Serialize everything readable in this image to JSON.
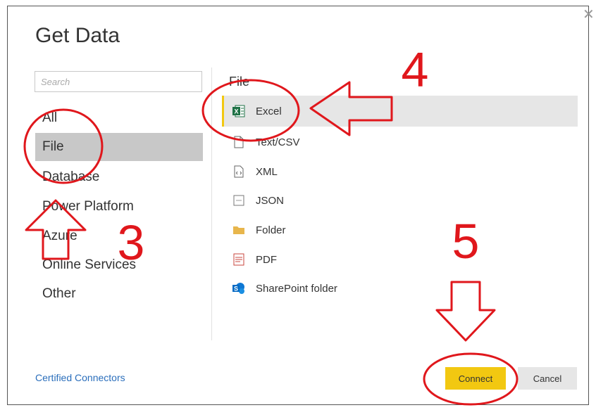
{
  "dialog": {
    "title": "Get Data",
    "close_glyph": "✕",
    "search": {
      "placeholder": "Search",
      "value": ""
    },
    "categories": [
      {
        "label": "All",
        "selected": false
      },
      {
        "label": "File",
        "selected": true
      },
      {
        "label": "Database",
        "selected": false
      },
      {
        "label": "Power Platform",
        "selected": false
      },
      {
        "label": "Azure",
        "selected": false
      },
      {
        "label": "Online Services",
        "selected": false
      },
      {
        "label": "Other",
        "selected": false
      }
    ],
    "section_label": "File",
    "items": [
      {
        "label": "Excel",
        "icon": "excel-icon",
        "selected": true
      },
      {
        "label": "Text/CSV",
        "icon": "text-file-icon",
        "selected": false
      },
      {
        "label": "XML",
        "icon": "xml-file-icon",
        "selected": false
      },
      {
        "label": "JSON",
        "icon": "json-file-icon",
        "selected": false
      },
      {
        "label": "Folder",
        "icon": "folder-icon",
        "selected": false
      },
      {
        "label": "PDF",
        "icon": "pdf-icon",
        "selected": false
      },
      {
        "label": "SharePoint folder",
        "icon": "sharepoint-icon",
        "selected": false
      }
    ],
    "certified_link": "Certified Connectors",
    "connect_label": "Connect",
    "cancel_label": "Cancel"
  },
  "annotations": {
    "step_3": "3",
    "step_4": "4",
    "step_5": "5",
    "color": "#e0171c"
  },
  "colors": {
    "accent_yellow": "#f2c811",
    "selected_category_bg": "#c8c8c8",
    "selected_item_bg": "#e6e6e6",
    "link_blue": "#2a6ebb"
  }
}
